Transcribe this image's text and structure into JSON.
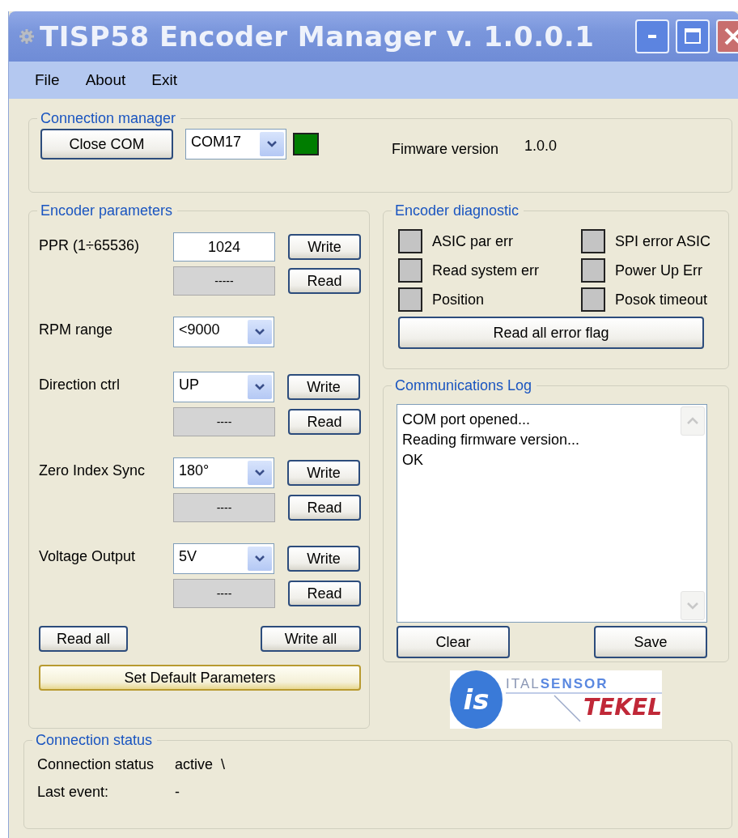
{
  "window": {
    "title": "TISP58 Encoder Manager v. 1.0.0.1"
  },
  "menu": [
    "File",
    "About",
    "Exit"
  ],
  "connection_manager": {
    "title": "Connection manager",
    "button": "Close COM",
    "port": "COM17",
    "connected": true,
    "firmware_label": "Fimware version",
    "firmware_value": "1.0.0"
  },
  "encoder_parameters": {
    "title": "Encoder parameters",
    "rows": [
      {
        "label": "PPR (1÷65536)",
        "kind": "text",
        "value": "1024",
        "readback": "-----",
        "write": "Write",
        "read": "Read"
      },
      {
        "label": "RPM range",
        "kind": "select",
        "value": "<9000"
      },
      {
        "label": "Direction ctrl",
        "kind": "select",
        "value": "UP",
        "readback": "----",
        "write": "Write",
        "read": "Read"
      },
      {
        "label": "Zero Index Sync",
        "kind": "select",
        "value": "180°",
        "readback": "----",
        "write": "Write",
        "read": "Read"
      },
      {
        "label": "Voltage Output",
        "kind": "select",
        "value": "5V",
        "readback": "----",
        "write": "Write",
        "read": "Read"
      }
    ],
    "read_all": "Read all",
    "write_all": "Write all",
    "defaults": "Set Default Parameters"
  },
  "diagnostic": {
    "title": "Encoder diagnostic",
    "flags": [
      {
        "label": "ASIC par err",
        "on": false
      },
      {
        "label": "SPI error ASIC",
        "on": false
      },
      {
        "label": "Read system err",
        "on": false
      },
      {
        "label": "Power Up Err",
        "on": false
      },
      {
        "label": "Position",
        "on": false
      },
      {
        "label": "Posok timeout",
        "on": false
      }
    ],
    "button": "Read all error flag"
  },
  "log": {
    "title": "Communications Log",
    "lines": [
      "COM port opened...",
      "Reading firmware version...",
      "OK"
    ],
    "clear": "Clear",
    "save": "Save"
  },
  "logo": {
    "mark": "is",
    "word_1": "ITAL",
    "word_2": "SENSOR",
    "word_3": "TEKEL"
  },
  "connection_status": {
    "title": "Connection status",
    "rows": [
      {
        "label": "Connection status",
        "value": "active  \\"
      },
      {
        "label": "Last event:",
        "value": "-"
      }
    ]
  }
}
